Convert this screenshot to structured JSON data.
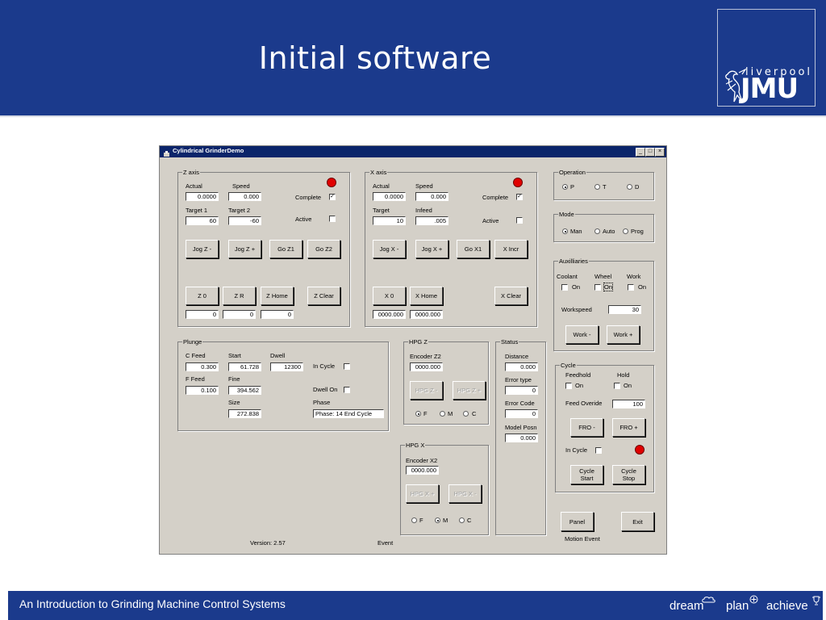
{
  "slide": {
    "title": "Initial software",
    "logo_small": "liverpool",
    "logo_big": "JMU",
    "footer_text": "An Introduction to Grinding Machine Control Systems",
    "slogan": [
      "dream",
      "plan",
      "achieve"
    ]
  },
  "app": {
    "title": "Cylindrical GrinderDemo",
    "window_buttons": [
      "_",
      "□",
      "×"
    ],
    "version": "Version: 2.57",
    "event": "Event",
    "motion_event": "Motion Event"
  },
  "zaxis": {
    "group": "Z axis",
    "actual_label": "Actual",
    "speed_label": "Speed",
    "actual": "0.0000",
    "speed": "0.000",
    "complete_label": "Complete",
    "complete_checked": "✓",
    "target1_label": "Target 1",
    "target2_label": "Target 2",
    "target1": "60",
    "target2": "-60",
    "active_label": "Active",
    "buttons": [
      "Jog Z -",
      "Jog Z +",
      "Go Z1",
      "Go Z2"
    ],
    "buttons2": [
      "Z 0",
      "Z R",
      "Z Home",
      "Z Clear"
    ],
    "fields": [
      "0",
      "0",
      "0"
    ]
  },
  "xaxis": {
    "group": "X axis",
    "actual_label": "Actual",
    "speed_label": "Speed",
    "actual": "0.0000",
    "speed": "0.000",
    "complete_label": "Complete",
    "complete_checked": "✓",
    "target_label": "Target",
    "infeed_label": "Infeed",
    "target": "10",
    "infeed": ".005",
    "active_label": "Active",
    "buttons": [
      "Jog X -",
      "Jog X +",
      "Go X1",
      "X Incr"
    ],
    "buttons2": [
      "X 0",
      "X Home",
      "X Clear"
    ],
    "fields": [
      "0000.000",
      "0000.000"
    ]
  },
  "operation": {
    "group": "Operation",
    "options": [
      "P",
      "T",
      "D"
    ],
    "selected": "P"
  },
  "mode": {
    "group": "Mode",
    "options": [
      "Man",
      "Auto",
      "Prog"
    ],
    "selected": "Man"
  },
  "aux": {
    "group": "Auxilliaries",
    "cols": [
      "Coolant",
      "Wheel",
      "Work"
    ],
    "on": "On",
    "workspeed_label": "Workspeed",
    "workspeed": "30",
    "buttons": [
      "Work -",
      "Work +"
    ]
  },
  "plunge": {
    "group": "Plunge",
    "cfeed_label": "C Feed",
    "start_label": "Start",
    "dwell_label": "Dwell",
    "cfeed": "0.300",
    "start": "61.728",
    "dwell": "12300",
    "incycle_label": "In Cycle",
    "ffeed_label": "F Feed",
    "fine_label": "Fine",
    "ffeed": "0.100",
    "fine": "394.562",
    "dwellon_label": "Dwell On",
    "size_label": "Size",
    "size": "272.838",
    "phase_label": "Phase",
    "phase": "Phase:  14 End Cycle"
  },
  "hpgz": {
    "group": "HPG Z",
    "encoder_label": "Encoder Z2",
    "encoder": "0000.000",
    "buttons": [
      "HPG Z -",
      "HPG Z +"
    ],
    "options": [
      "F",
      "M",
      "C"
    ],
    "selected": "F"
  },
  "hpgx": {
    "group": "HPG X",
    "encoder_label": "Encoder X2",
    "encoder": "0000.000",
    "buttons": [
      "HPG X +",
      "HPG X -"
    ],
    "options": [
      "F",
      "M",
      "C"
    ],
    "selected": "M"
  },
  "status": {
    "group": "Status",
    "distance_label": "Distance",
    "distance": "0.000",
    "errortype_label": "Error type",
    "errortype": "0",
    "errorcode_label": "Error Code",
    "errorcode": "0",
    "modelposn_label": "Model Posn",
    "modelposn": "0.000"
  },
  "cycle": {
    "group": "Cycle",
    "feedhold_label": "Feedhold",
    "hold_label": "Hold",
    "on": "On",
    "feedoverride_label": "Feed Overide",
    "feedoverride": "100",
    "fro_minus": "FRO -",
    "fro_plus": "FRO +",
    "incycle_label": "In Cycle",
    "cycle_start": [
      "Cycle",
      "Start"
    ],
    "cycle_stop": [
      "Cycle",
      "Stop"
    ]
  },
  "bottom_buttons": {
    "panel": "Panel",
    "exit": "Exit"
  }
}
